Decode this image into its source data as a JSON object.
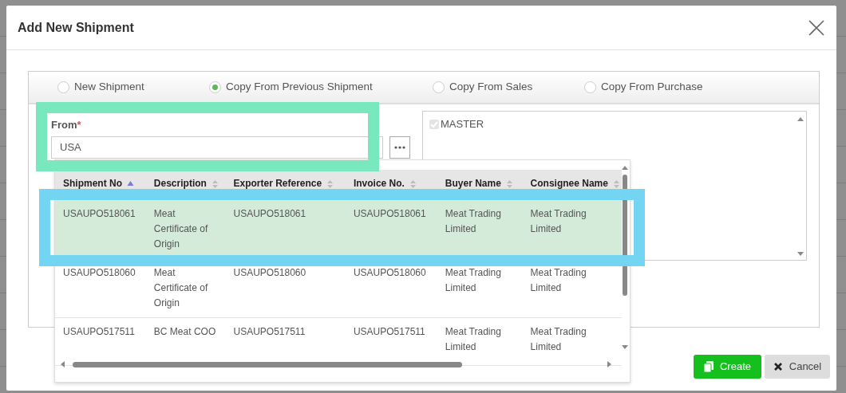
{
  "dialog": {
    "title": "Add New Shipment"
  },
  "modes": [
    {
      "label": "New Shipment",
      "selected": false
    },
    {
      "label": "Copy From Previous Shipment",
      "selected": true
    },
    {
      "label": "Copy From Sales",
      "selected": false
    },
    {
      "label": "Copy From Purchase",
      "selected": false
    }
  ],
  "from": {
    "label": "From",
    "required_mark": "*",
    "value": "USA"
  },
  "options": [
    {
      "label": "MASTER",
      "checked": true,
      "disabled": true
    }
  ],
  "results": {
    "columns": [
      {
        "label": "Shipment No",
        "sorted": true
      },
      {
        "label": "Description",
        "sorted": false
      },
      {
        "label": "Exporter Reference",
        "sorted": false
      },
      {
        "label": "Invoice No.",
        "sorted": false
      },
      {
        "label": "Buyer Name",
        "sorted": false
      },
      {
        "label": "Consignee Name",
        "sorted": false
      }
    ],
    "rows": [
      {
        "selected": true,
        "cells": [
          "USAUPO518061",
          "Meat Certificate of Origin",
          "USAUPO518061",
          "USAUPO518061",
          "Meat Trading Limited",
          "Meat Trading Limited"
        ]
      },
      {
        "selected": false,
        "cells": [
          "USAUPO518060",
          "Meat Certificate of Origin",
          "USAUPO518060",
          "USAUPO518060",
          "Meat Trading Limited",
          "Meat Trading Limited"
        ]
      },
      {
        "selected": false,
        "cells": [
          "USAUPO517511",
          "BC Meat COO",
          "USAUPO517511",
          "USAUPO517511",
          "Meat Trading Limited",
          "Meat Trading Limited"
        ]
      }
    ]
  },
  "buttons": [
    {
      "kind": "create",
      "label": "Create"
    },
    {
      "kind": "cancel",
      "label": "Cancel"
    }
  ],
  "highlights": [
    {
      "kind": "field",
      "color": "#7ae8bf"
    },
    {
      "kind": "row",
      "color": "#74d5f2"
    }
  ]
}
